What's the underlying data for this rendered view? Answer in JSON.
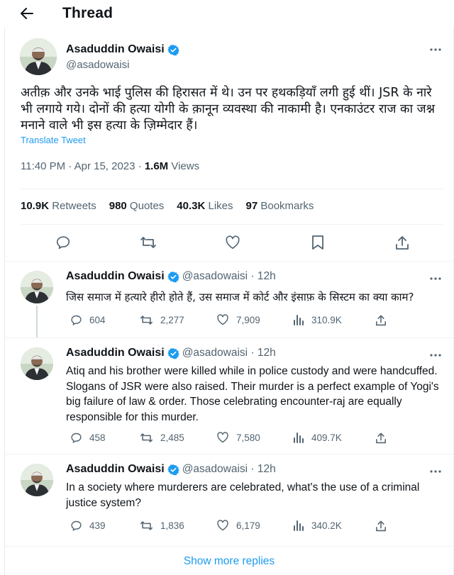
{
  "header": {
    "title": "Thread"
  },
  "main_tweet": {
    "name": "Asaduddin Owaisi",
    "handle": "@asadowaisi",
    "text": "अतीक़ और उनके भाई पुलिस की हिरासत में थे। उन पर हथकड़ियाँ लगी हुई थीं। JSR के नारे भी लगाये गये। दोनों की हत्या योगी के क़ानून व्यवस्था की नाकामी है। एनकाउंटर राज का जश्न मनाने वाले भी इस हत्या के ज़िम्मेदार हैं।",
    "translate_label": "Translate Tweet",
    "time": "11:40 PM · Apr 15, 2023 · ",
    "views_count": "1.6M",
    "views_label": " Views",
    "stats": {
      "retweets_count": "10.9K",
      "retweets_label": " Retweets",
      "quotes_count": "980",
      "quotes_label": " Quotes",
      "likes_count": "40.3K",
      "likes_label": " Likes",
      "bookmarks_count": "97",
      "bookmarks_label": " Bookmarks"
    }
  },
  "replies": [
    {
      "name": "Asaduddin Owaisi",
      "handle": "@asadowaisi · 12h",
      "text": "जिस समाज में हत्यारे हीरो होते हैं, उस समाज में कोर्ट और इंसाफ़ के सिस्टम का क्या काम?",
      "replies": "604",
      "retweets": "2,277",
      "likes": "7,909",
      "views": "310.9K"
    },
    {
      "name": "Asaduddin Owaisi",
      "handle": "@asadowaisi · 12h",
      "text": "Atiq and his brother were killed while in police custody and were handcuffed. Slogans of JSR were also raised. Their murder is a perfect example of Yogi's big failure of law & order. Those celebrating encounter-raj are equally responsible for this murder.",
      "replies": "458",
      "retweets": "2,485",
      "likes": "7,580",
      "views": "409.7K"
    },
    {
      "name": "Asaduddin Owaisi",
      "handle": "@asadowaisi · 12h",
      "text": "In a society where murderers are celebrated, what's the use of a criminal justice system?",
      "replies": "439",
      "retweets": "1,836",
      "likes": "6,179",
      "views": "340.2K"
    }
  ],
  "show_more_label": "Show more replies",
  "colors": {
    "accent": "#1d9bf0",
    "text": "#0f1419",
    "secondary": "#536471"
  },
  "icons": [
    "back-arrow-icon",
    "verified-badge-icon",
    "more-icon",
    "reply-icon",
    "retweet-icon",
    "like-icon",
    "bookmark-icon",
    "share-icon",
    "views-icon"
  ]
}
